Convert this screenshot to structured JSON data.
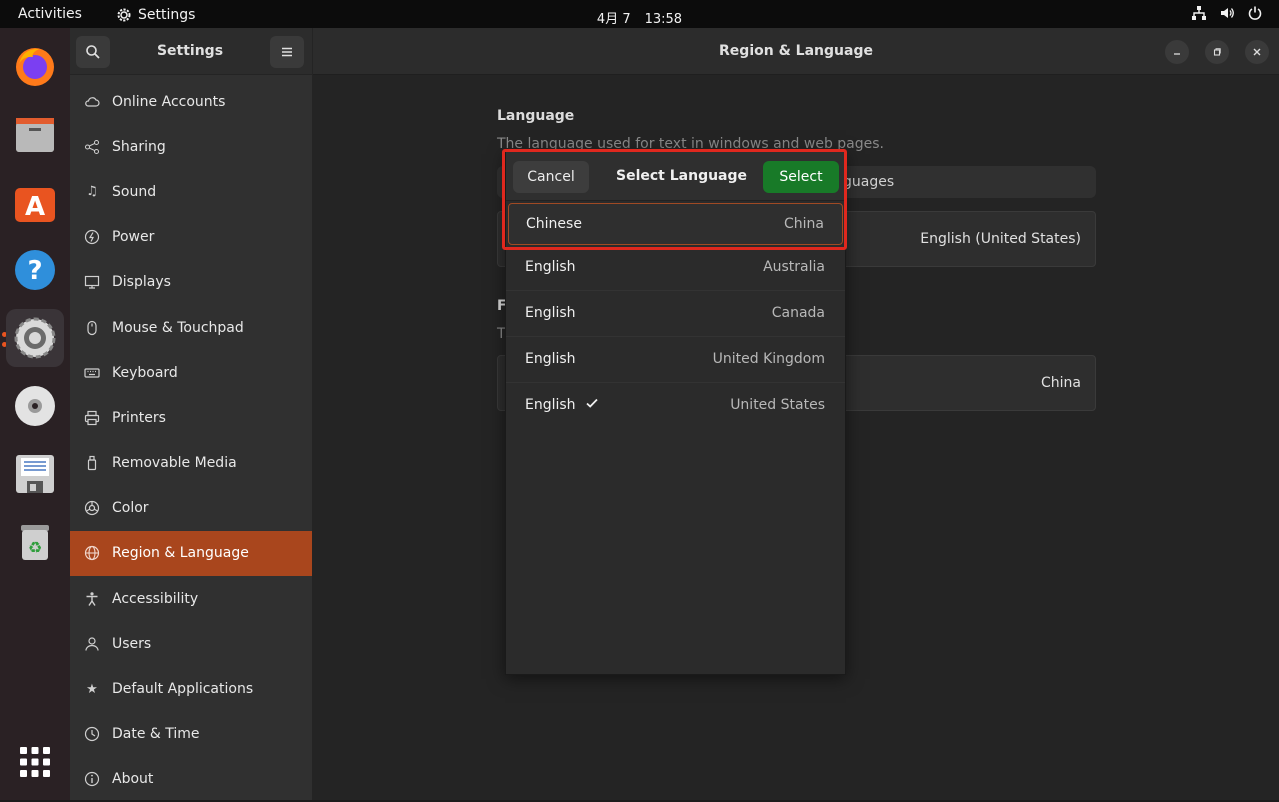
{
  "topbar": {
    "activities": "Activities",
    "app_name": "Settings",
    "date": "4月 7",
    "time": "13:58"
  },
  "dock": {
    "items": [
      "firefox-icon",
      "files-icon",
      "app-center-icon",
      "help-icon",
      "settings-icon",
      "disc-icon",
      "save-icon",
      "trash-icon",
      "app-grid-icon"
    ]
  },
  "sidebar": {
    "title": "Settings",
    "items": [
      {
        "label": "Online Accounts",
        "icon": "cloud-icon"
      },
      {
        "label": "Sharing",
        "icon": "share-icon"
      },
      {
        "label": "Sound",
        "icon": "music-note-icon"
      },
      {
        "label": "Power",
        "icon": "power-icon"
      },
      {
        "label": "Displays",
        "icon": "monitor-icon"
      },
      {
        "label": "Mouse & Touchpad",
        "icon": "mouse-icon"
      },
      {
        "label": "Keyboard",
        "icon": "keyboard-icon"
      },
      {
        "label": "Printers",
        "icon": "printer-icon"
      },
      {
        "label": "Removable Media",
        "icon": "usb-icon"
      },
      {
        "label": "Color",
        "icon": "color-icon"
      },
      {
        "label": "Region & Language",
        "icon": "globe-icon"
      },
      {
        "label": "Accessibility",
        "icon": "accessibility-icon"
      },
      {
        "label": "Users",
        "icon": "users-icon"
      },
      {
        "label": "Default Applications",
        "icon": "star-icon"
      },
      {
        "label": "Date & Time",
        "icon": "clock-icon"
      },
      {
        "label": "About",
        "icon": "info-icon"
      }
    ],
    "selected": "Region & Language"
  },
  "main": {
    "title": "Region & Language",
    "language_heading": "Language",
    "language_desc": "The language used for text in windows and web pages.",
    "language_box_text": "guages",
    "language_value": "English (United States)",
    "formats_heading": "F",
    "formats_desc": "T",
    "formats_value": "China"
  },
  "dialog": {
    "title": "Select Language",
    "cancel_label": "Cancel",
    "select_label": "Select",
    "rows": [
      {
        "language": "Chinese",
        "region": "China",
        "checked": false
      },
      {
        "language": "English",
        "region": "Australia",
        "checked": false
      },
      {
        "language": "English",
        "region": "Canada",
        "checked": false
      },
      {
        "language": "English",
        "region": "United Kingdom",
        "checked": false
      },
      {
        "language": "English",
        "region": "United States",
        "checked": true
      }
    ]
  },
  "colors": {
    "accent": "#a9461d",
    "select_button": "#187a28",
    "highlight": "#e0281e"
  }
}
